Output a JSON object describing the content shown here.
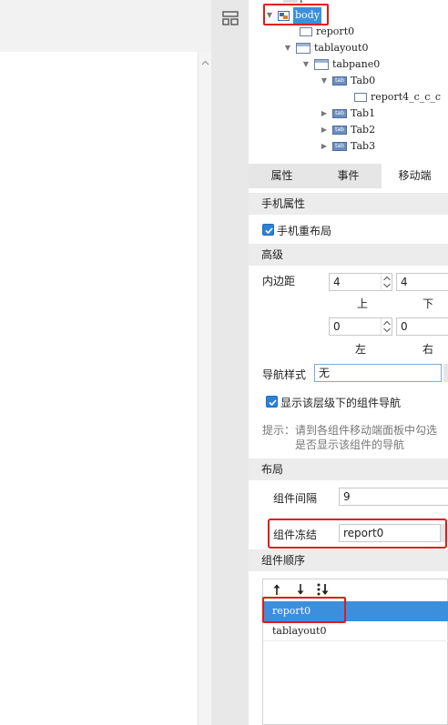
{
  "tree": {
    "partial_top": "para",
    "nodes": [
      {
        "label": "body",
        "icon": "body-icon",
        "expanded": true,
        "selected": true
      },
      {
        "label": "report0",
        "icon": "report-icon"
      },
      {
        "label": "tablayout0",
        "icon": "tablayout-icon",
        "expanded": true
      },
      {
        "label": "tabpane0",
        "icon": "tabpane-icon",
        "expanded": true
      },
      {
        "label": "Tab0",
        "icon": "tab-icon",
        "expanded": true
      },
      {
        "label": "report4_c_c_c",
        "icon": "report-icon"
      },
      {
        "label": "Tab1",
        "icon": "tab-icon",
        "expanded": false
      },
      {
        "label": "Tab2",
        "icon": "tab-icon",
        "expanded": false
      },
      {
        "label": "Tab3",
        "icon": "tab-icon",
        "expanded": false
      }
    ],
    "tab_icon_text": "tab"
  },
  "tabs": [
    "属性",
    "事件",
    "移动端"
  ],
  "active_tab": 2,
  "mobile_props": {
    "section_title": "手机属性",
    "relayout_label": "手机重布局",
    "relayout_checked": true
  },
  "advanced": {
    "section_title": "高级",
    "padding_label": "内边距",
    "top_value": "4",
    "bottom_value": "4",
    "left_value": "0",
    "right_value": "0",
    "top_label": "上",
    "bottom_label": "下",
    "left_label": "左",
    "right_label": "右",
    "nav_style_label": "导航样式",
    "nav_style_value": "无",
    "show_nav_label": "显示该层级下的组件导航",
    "show_nav_checked": true,
    "hint_line1": "提示：请到各组件移动端面板中勾选",
    "hint_line2": "是否显示该组件的导航"
  },
  "layout": {
    "section_title": "布局",
    "gap_label": "组件间隔",
    "gap_value": "9",
    "freeze_label": "组件冻结",
    "freeze_value": "report0"
  },
  "order": {
    "section_title": "组件顺序",
    "items": [
      "report0",
      "tablayout0"
    ],
    "selected_index": 0
  },
  "colors": {
    "accent": "#3c8fdd",
    "highlight": "#e01b1b"
  }
}
